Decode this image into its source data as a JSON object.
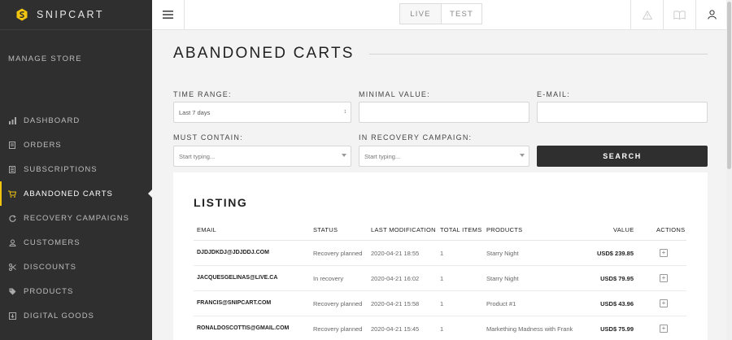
{
  "brand": {
    "name": "SNIPCART"
  },
  "sidebar": {
    "section_title": "MANAGE STORE",
    "items": [
      {
        "label": "DASHBOARD",
        "icon": "bar-chart-icon"
      },
      {
        "label": "ORDERS",
        "icon": "document-icon"
      },
      {
        "label": "SUBSCRIPTIONS",
        "icon": "list-icon"
      },
      {
        "label": "ABANDONED CARTS",
        "icon": "cart-icon",
        "active": true
      },
      {
        "label": "RECOVERY CAMPAIGNS",
        "icon": "refresh-icon"
      },
      {
        "label": "CUSTOMERS",
        "icon": "user-icon"
      },
      {
        "label": "DISCOUNTS",
        "icon": "scissors-icon"
      },
      {
        "label": "PRODUCTS",
        "icon": "tag-icon"
      },
      {
        "label": "DIGITAL GOODS",
        "icon": "download-icon"
      }
    ]
  },
  "topbar": {
    "env": {
      "live": "LIVE",
      "test": "TEST",
      "selected": "TEST"
    },
    "icons": [
      "warning-icon",
      "book-icon",
      "user-icon"
    ]
  },
  "page": {
    "title": "ABANDONED CARTS"
  },
  "filters": {
    "time_range": {
      "label": "TIME RANGE:",
      "value": "Last 7 days"
    },
    "minimal_value": {
      "label": "MINIMAL VALUE:",
      "value": ""
    },
    "email": {
      "label": "E-MAIL:",
      "value": ""
    },
    "must_contain": {
      "label": "MUST CONTAIN:",
      "placeholder": "Start typing..."
    },
    "recovery_campaign": {
      "label": "IN RECOVERY CAMPAIGN:",
      "placeholder": "Start typing..."
    },
    "search_label": "SEARCH"
  },
  "listing": {
    "title": "LISTING",
    "columns": [
      "EMAIL",
      "STATUS",
      "LAST MODIFICATION",
      "TOTAL ITEMS",
      "PRODUCTS",
      "VALUE",
      "ACTIONS"
    ],
    "rows": [
      {
        "email": "DJDJDKDJ@JDJDDJ.COM",
        "status": "Recovery planned",
        "modified": "2020-04-21 18:55",
        "items": "1",
        "products": "Starry Night",
        "value": "USD$ 239.85"
      },
      {
        "email": "JACQUESGELINAS@LIVE.CA",
        "status": "In recovery",
        "modified": "2020-04-21 16:02",
        "items": "1",
        "products": "Starry Night",
        "value": "USD$ 79.95"
      },
      {
        "email": "FRANCIS@SNIPCART.COM",
        "status": "Recovery planned",
        "modified": "2020-04-21 15:58",
        "items": "1",
        "products": "Product #1",
        "value": "USD$ 43.96"
      },
      {
        "email": "RONALDOSCOTTIS@GMAIL.COM",
        "status": "Recovery planned",
        "modified": "2020-04-21 15:45",
        "items": "1",
        "products": "Markething Madness with Frank",
        "value": "USD$ 75.99"
      }
    ]
  },
  "colors": {
    "sidebar_bg": "#2f2f2f",
    "accent": "#f1c40f",
    "button_bg": "#2f2f2f"
  }
}
